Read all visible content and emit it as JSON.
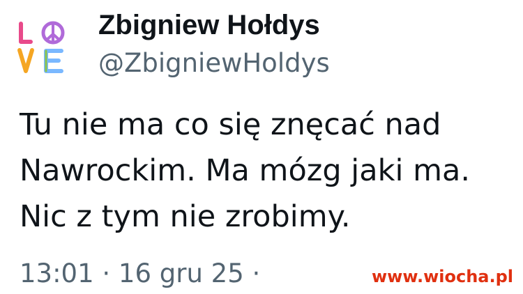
{
  "tweet": {
    "avatar": {
      "icon": "love-peace-logo-icon",
      "logo_text": "LOVE",
      "colors": [
        "#e84a8a",
        "#7ab8ff",
        "#f5a623",
        "#8bc34a",
        "#b06ad9"
      ]
    },
    "author": {
      "display_name": "Zbigniew Hołdys",
      "handle": "@ZbigniewHoldys"
    },
    "text_lines": [
      "Tu nie ma co się znęcać nad",
      "Nawrockim. Ma mózg jaki ma.",
      "Nic z tym nie zrobimy."
    ],
    "timestamp": "13:01 · 16 gru 25 ·"
  },
  "watermark": {
    "text": "www.wiocha.pl",
    "color": "#e03010"
  },
  "colors": {
    "primary_text": "#0f1419",
    "secondary_text": "#536471",
    "background": "#ffffff"
  }
}
